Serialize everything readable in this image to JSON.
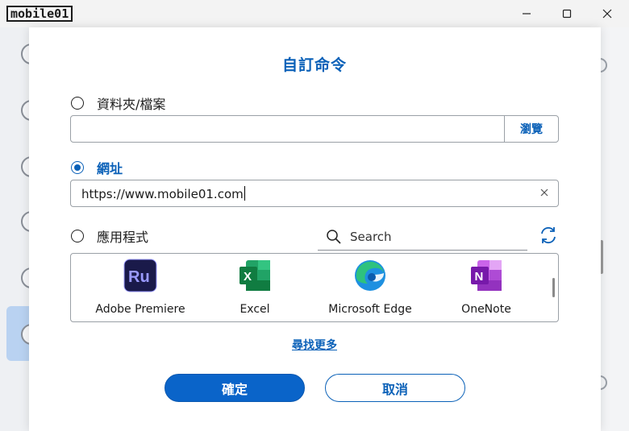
{
  "window": {
    "logo_text": "mobile01",
    "minimize_label": "",
    "maximize_label": "",
    "close_label": ""
  },
  "dialog": {
    "title": "自訂命令",
    "options": {
      "folder_file": {
        "label": "資料夾/檔案",
        "selected": false,
        "path_value": "",
        "browse_label": "瀏覽"
      },
      "url": {
        "label": "網址",
        "selected": true,
        "value": "https://www.mobile01.com"
      },
      "app": {
        "label": "應用程式",
        "selected": false
      }
    },
    "search": {
      "placeholder": "Search"
    },
    "apps": [
      {
        "name": "Adobe Premiere",
        "icon": "adobe-premiere-rush-icon"
      },
      {
        "name": "Excel",
        "icon": "excel-icon"
      },
      {
        "name": "Microsoft Edge",
        "icon": "edge-icon"
      },
      {
        "name": "OneNote",
        "icon": "onenote-icon"
      }
    ],
    "find_more_label": "尋找更多",
    "ok_label": "確定",
    "cancel_label": "取消"
  },
  "colors": {
    "accent": "#0b61b8",
    "primary_button": "#0a64c9",
    "premiere": "#1a1a4a",
    "excel": "#107c41",
    "onenote": "#7719aa"
  }
}
